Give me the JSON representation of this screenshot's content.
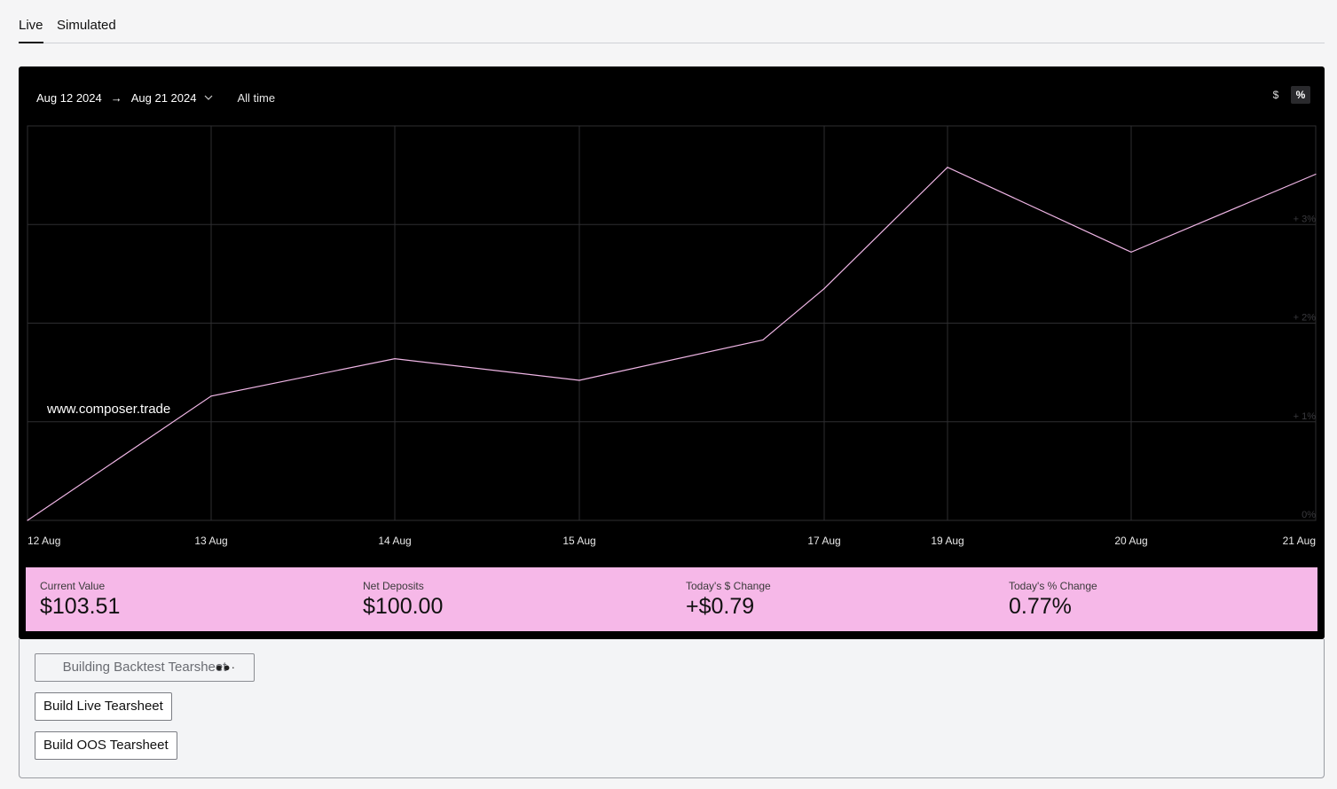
{
  "tabs": [
    {
      "label": "Live",
      "active": true
    },
    {
      "label": "Simulated",
      "active": false
    }
  ],
  "toolbar": {
    "start_date": "Aug 12 2024",
    "end_date": "Aug 21 2024",
    "range_preset": "All time",
    "unit_dollar": "$",
    "unit_percent": "%",
    "selected_unit": "%"
  },
  "watermark": "www.composer.trade",
  "chart_data": {
    "type": "line",
    "x": [
      "12 Aug",
      "13 Aug",
      "14 Aug",
      "15 Aug",
      "16 Aug",
      "17 Aug",
      "19 Aug",
      "20 Aug",
      "21 Aug"
    ],
    "x_tick_labels": [
      "12 Aug",
      "13 Aug",
      "14 Aug",
      "15 Aug",
      "17 Aug",
      "19 Aug",
      "20 Aug",
      "21 Aug"
    ],
    "series": [
      {
        "values": [
          0.0,
          1.26,
          1.64,
          1.42,
          1.83,
          2.35,
          3.58,
          2.72,
          3.51
        ]
      }
    ],
    "y_tick_labels": [
      "0%",
      "+ 1%",
      "+ 2%",
      "+ 3%"
    ],
    "ylim": [
      0,
      4
    ],
    "grid": true,
    "line_color": "#f0b6e6"
  },
  "stats": [
    {
      "label": "Current Value",
      "value": "$103.51"
    },
    {
      "label": "Net Deposits",
      "value": "$100.00"
    },
    {
      "label": "Today's $ Change",
      "value": "+$0.79"
    },
    {
      "label": "Today's % Change",
      "value": "0.77%"
    }
  ],
  "actions": {
    "backtest": "Building Backtest Tearsheet",
    "live": "Build Live Tearsheet",
    "oos": "Build OOS Tearsheet"
  }
}
